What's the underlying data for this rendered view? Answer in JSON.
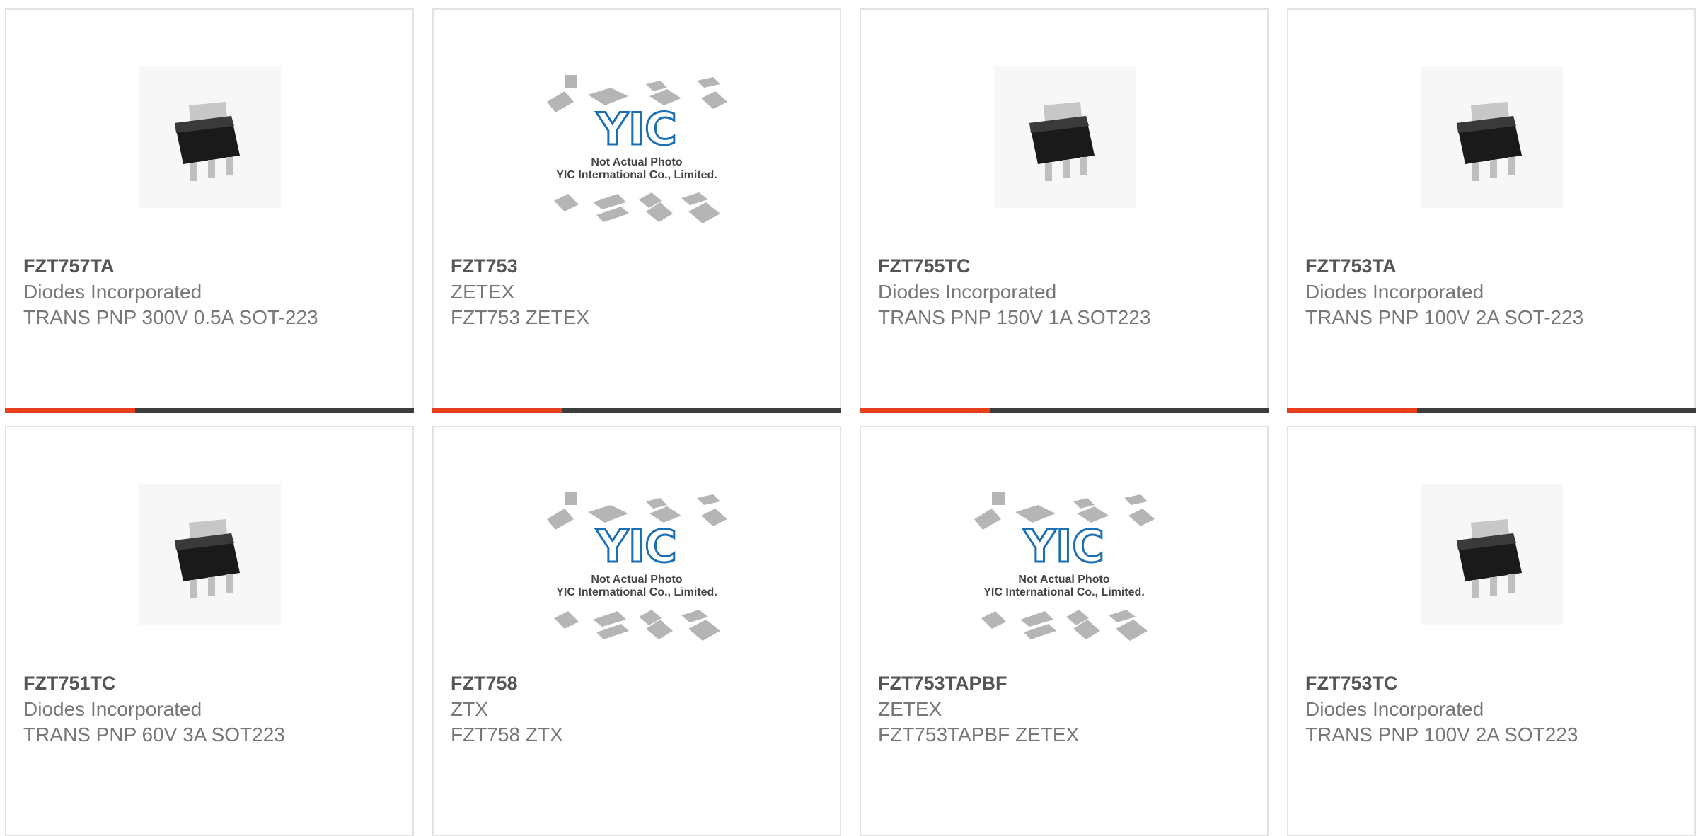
{
  "products": [
    {
      "part": "FZT757TA",
      "manufacturer": "Diodes Incorporated",
      "description": "TRANS PNP 300V 0.5A SOT-223",
      "image": "sot223-chip"
    },
    {
      "part": "FZT753",
      "manufacturer": "ZETEX",
      "description": "FZT753 ZETEX",
      "image": "yic-placeholder"
    },
    {
      "part": "FZT755TC",
      "manufacturer": "Diodes Incorporated",
      "description": "TRANS PNP 150V 1A SOT223",
      "image": "sot223-chip"
    },
    {
      "part": "FZT753TA",
      "manufacturer": "Diodes Incorporated",
      "description": "TRANS PNP 100V 2A SOT-223",
      "image": "sot223-chip"
    },
    {
      "part": "FZT751TC",
      "manufacturer": "Diodes Incorporated",
      "description": "TRANS PNP 60V 3A SOT223",
      "image": "sot223-chip"
    },
    {
      "part": "FZT758",
      "manufacturer": "ZTX",
      "description": "FZT758 ZTX",
      "image": "yic-placeholder"
    },
    {
      "part": "FZT753TAPBF",
      "manufacturer": "ZETEX",
      "description": "FZT753TAPBF ZETEX",
      "image": "yic-placeholder"
    },
    {
      "part": "FZT753TC",
      "manufacturer": "Diodes Incorporated",
      "description": "TRANS PNP 100V 2A SOT223",
      "image": "sot223-chip"
    }
  ],
  "placeholder": {
    "logo": "YIC",
    "line1": "Not Actual Photo",
    "line2": "YIC International Co., Limited."
  },
  "colors": {
    "accent": "#e8401c",
    "bar": "#3d3d3d",
    "border": "#e2e2e2"
  }
}
